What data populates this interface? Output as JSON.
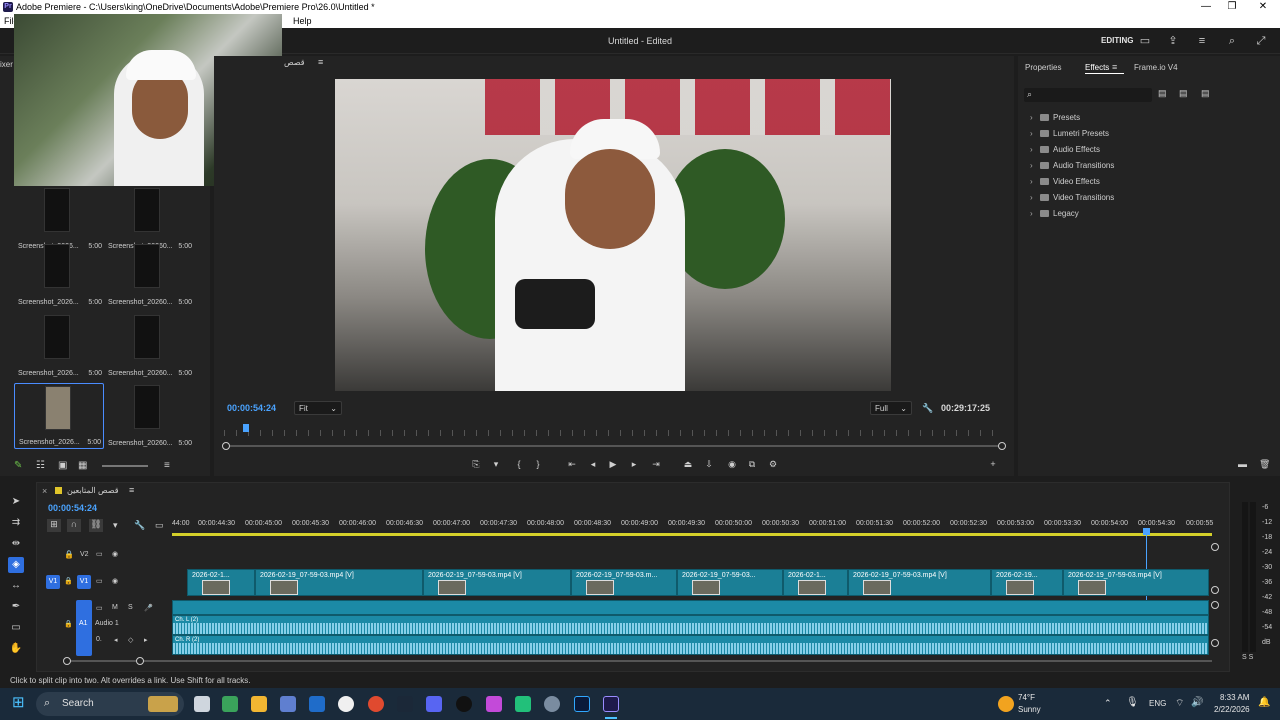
{
  "window": {
    "title": "Adobe Premiere - C:\\Users\\king\\OneDrive\\Documents\\Adobe\\Premiere Pro\\26.0\\Untitled *",
    "minimize": "—",
    "restore": "❐",
    "close": "✕"
  },
  "menu": {
    "file": "File",
    "help": "Help"
  },
  "header": {
    "document_status": "Untitled - Edited",
    "workspace": "EDITING"
  },
  "project": {
    "partial_tab": "ixer",
    "items": [
      {
        "name": "Screenshot_2026...",
        "duration": "5:00"
      },
      {
        "name": "Screenshot_20260...",
        "duration": "5:00"
      },
      {
        "name": "Screenshot_2026...",
        "duration": "5:00"
      },
      {
        "name": "Screenshot_20260...",
        "duration": "5:00"
      },
      {
        "name": "Screenshot_2026...",
        "duration": "5:00"
      },
      {
        "name": "Screenshot_20260...",
        "duration": "5:00"
      },
      {
        "name": "Screenshot_2026...",
        "duration": "5:00"
      },
      {
        "name": "Screenshot_20260...",
        "duration": "5:00"
      }
    ]
  },
  "monitor": {
    "sequence_tab": "قصص",
    "current_time": "00:00:54:24",
    "fit": "Fit",
    "quality": "Full",
    "duration": "00:29:17:25"
  },
  "effects_panel": {
    "tabs": [
      "Properties",
      "Effects",
      "Frame.io V4"
    ],
    "search_placeholder": "",
    "items": [
      "Presets",
      "Lumetri Presets",
      "Audio Effects",
      "Audio Transitions",
      "Video Effects",
      "Video Transitions",
      "Legacy"
    ]
  },
  "timeline": {
    "sequence_name": "قصص المتابعين",
    "timecode": "00:00:54:24",
    "ruler": [
      "44:00",
      "00:00:44:30",
      "00:00:45:00",
      "00:00:45:30",
      "00:00:46:00",
      "00:00:46:30",
      "00:00:47:00",
      "00:00:47:30",
      "00:00:48:00",
      "00:00:48:30",
      "00:00:49:00",
      "00:00:49:30",
      "00:00:50:00",
      "00:00:50:30",
      "00:00:51:00",
      "00:00:51:30",
      "00:00:52:00",
      "00:00:52:30",
      "00:00:53:00",
      "00:00:53:30",
      "00:00:54:00",
      "00:00:54:30",
      "00:00:55"
    ],
    "tracks": {
      "v2": "V2",
      "v1": "V1",
      "v1_source": "V1",
      "a1": "A1",
      "audio_name": "Audio 1",
      "m": "M",
      "s": "S",
      "vol": "0."
    },
    "video_clips": [
      "2026-02-1...",
      "2026-02-19_07-59-03.mp4 [V]",
      "2026-02-19_07-59-03.mp4 [V]",
      "2026-02-19_07-59-03.m...",
      "2026-02-19_07-59-03...",
      "2026-02-1...",
      "2026-02-19_07-59-03.mp4 [V]",
      "2026-02-19...",
      "2026-02-19_07-59-03.mp4 [V]"
    ],
    "audio_label_l": "Ch. L (2)",
    "audio_label_r": "Ch. R (2)"
  },
  "meter": {
    "labels": [
      "-6",
      "-12",
      "-18",
      "-24",
      "-30",
      "-36",
      "-42",
      "-48",
      "-54",
      "dB"
    ],
    "solo": "S S"
  },
  "status": {
    "text": "Click to split clip into two. Alt overrides a link. Use Shift for all tracks."
  },
  "taskbar": {
    "search": "Search",
    "weather_temp": "74°F",
    "weather_cond": "Sunny",
    "lang": "ENG",
    "time": "8:33 AM",
    "date": "2/22/2026"
  },
  "colors": {
    "accent": "#2f6fe0",
    "timecode": "#4aa3ff",
    "clip": "#1b7f96"
  }
}
